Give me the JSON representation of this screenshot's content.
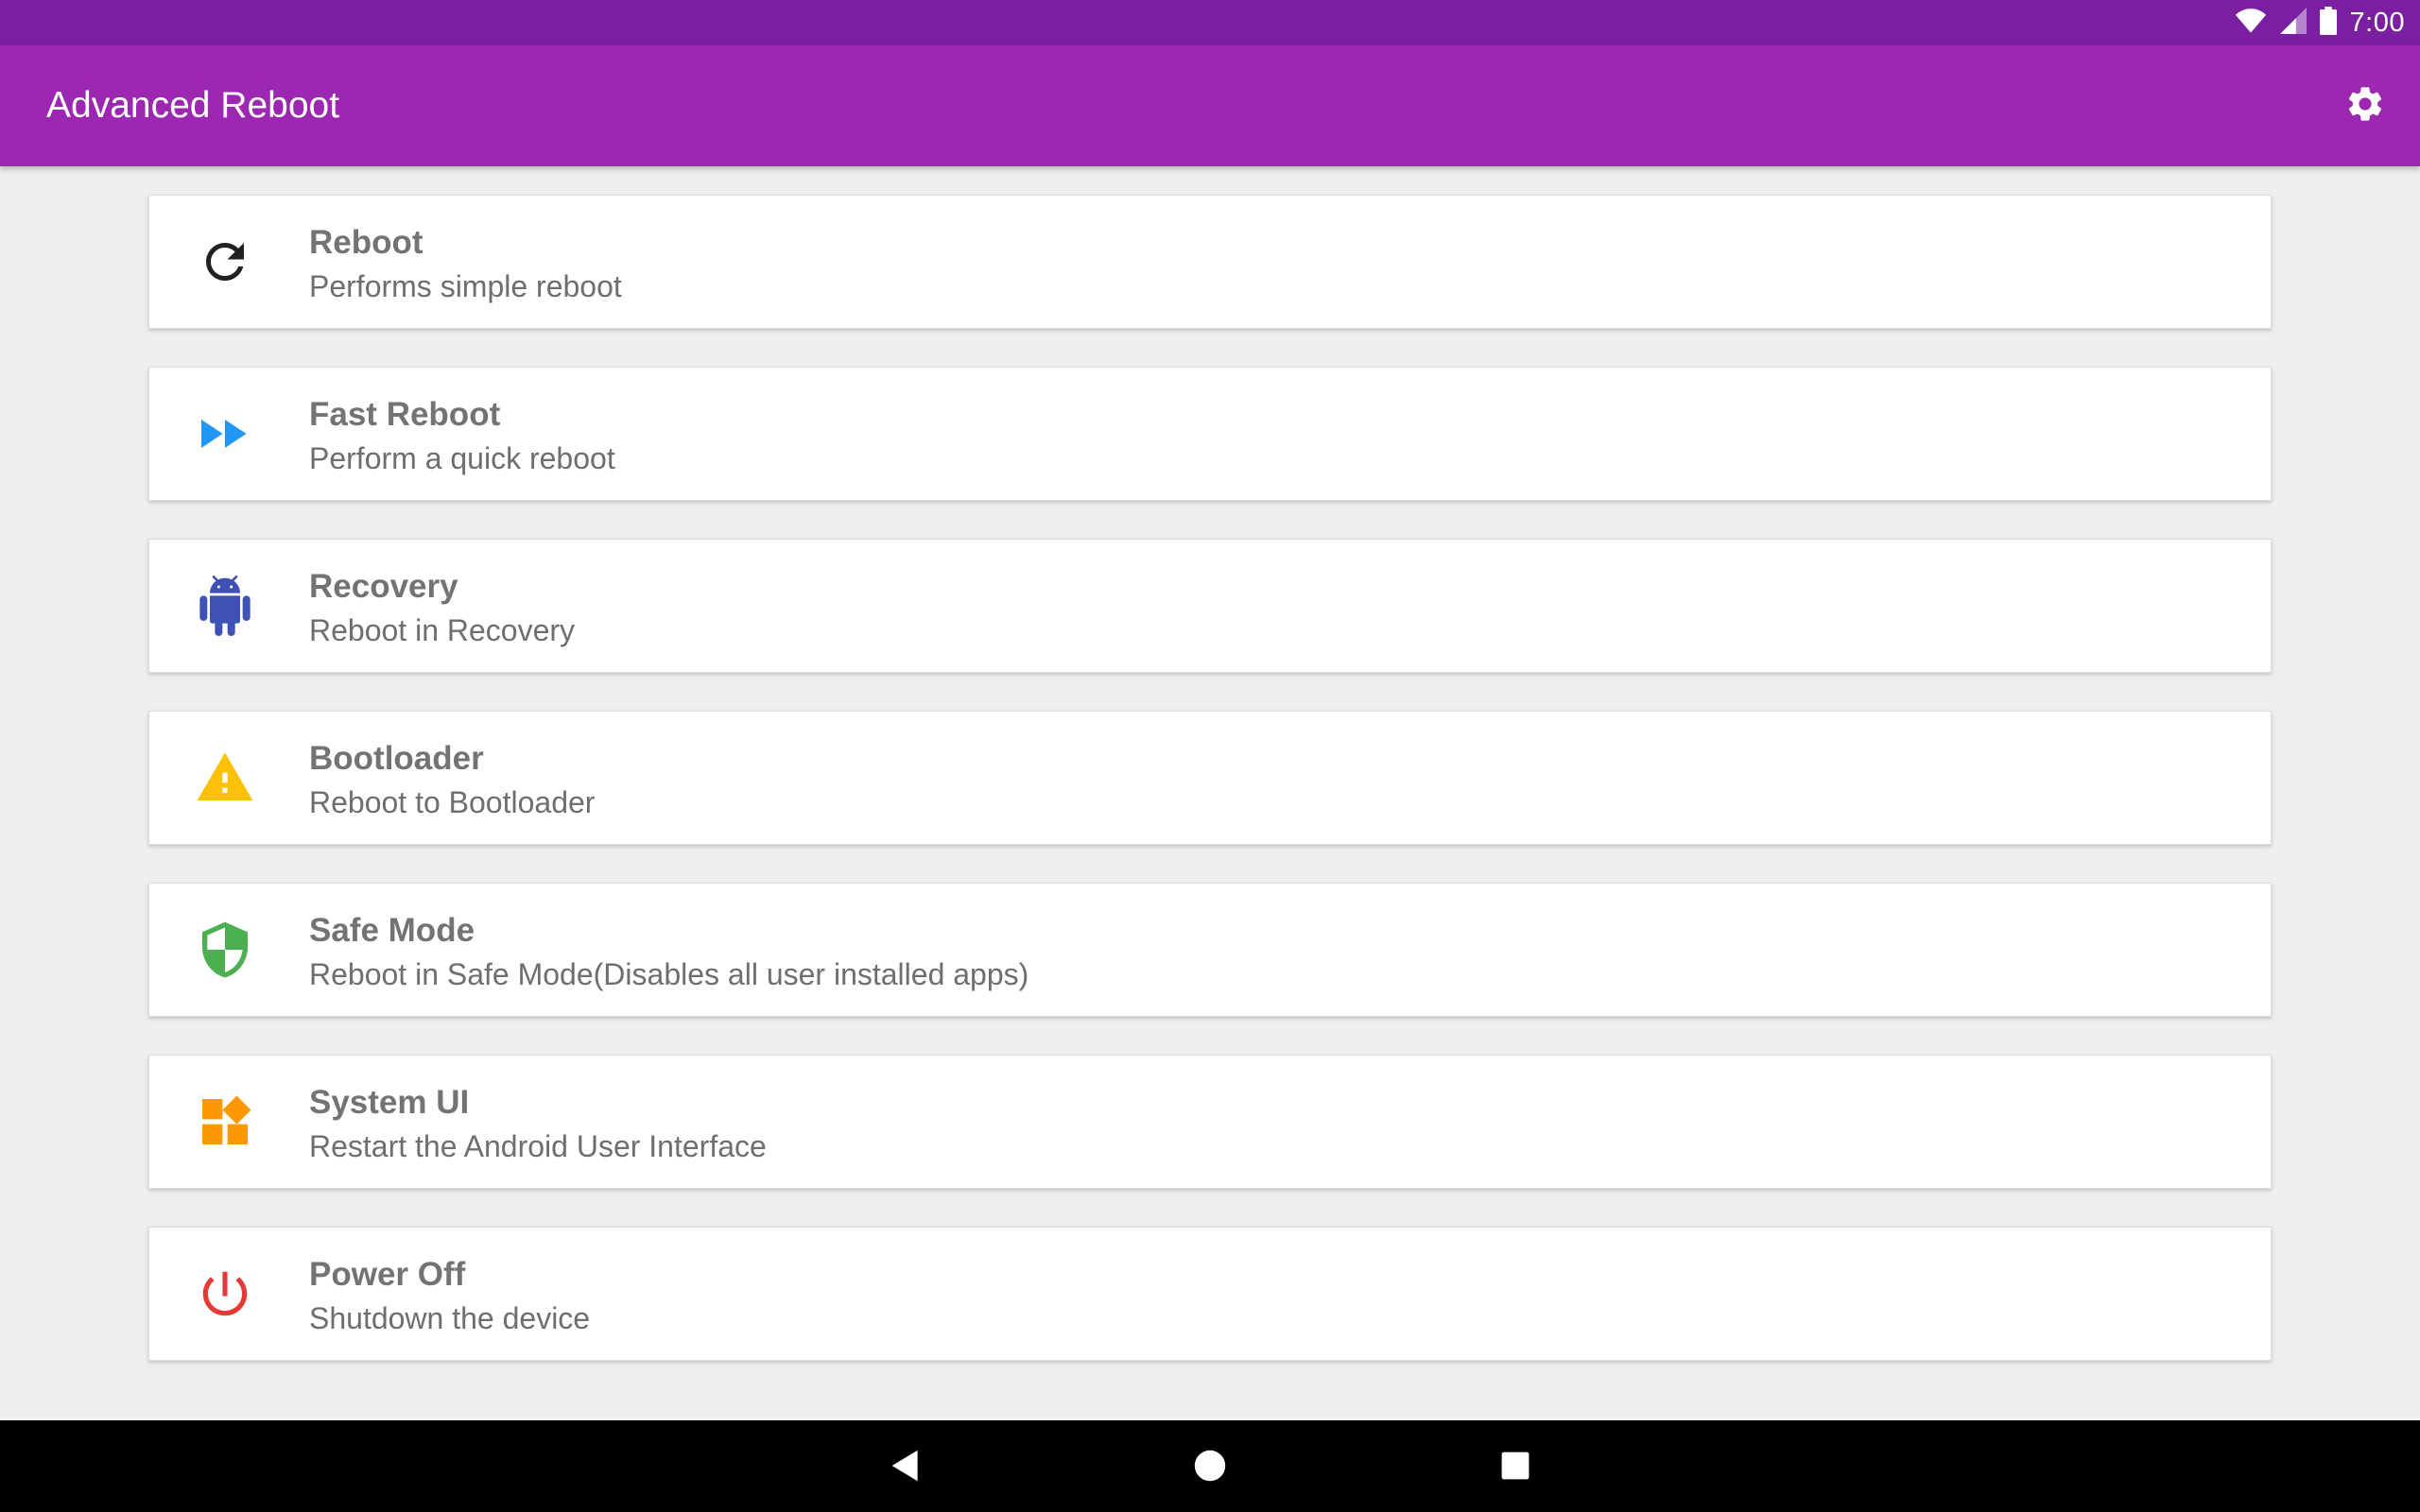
{
  "status_bar": {
    "time": "7:00",
    "icons": [
      "wifi-icon",
      "cell-signal-icon",
      "battery-icon"
    ]
  },
  "app_bar": {
    "title": "Advanced Reboot",
    "settings_icon": "gear-icon"
  },
  "options": [
    {
      "title": "Reboot",
      "subtitle": "Performs simple reboot",
      "icon": "refresh-icon",
      "icon_color": "#212121"
    },
    {
      "title": "Fast Reboot",
      "subtitle": "Perform a quick reboot",
      "icon": "fast-forward-icon",
      "icon_color": "#2196f3"
    },
    {
      "title": "Recovery",
      "subtitle": "Reboot in Recovery",
      "icon": "android-icon",
      "icon_color": "#3f51b5"
    },
    {
      "title": "Bootloader",
      "subtitle": "Reboot to Bootloader",
      "icon": "warning-icon",
      "icon_color": "#ffc107"
    },
    {
      "title": "Safe Mode",
      "subtitle": "Reboot in Safe Mode(Disables all user installed apps)",
      "icon": "shield-icon",
      "icon_color": "#4caf50"
    },
    {
      "title": "System UI",
      "subtitle": "Restart the Android User Interface",
      "icon": "widgets-icon",
      "icon_color": "#ff9800"
    },
    {
      "title": "Power Off",
      "subtitle": "Shutdown the device",
      "icon": "power-icon",
      "icon_color": "#e53935"
    }
  ],
  "nav_bar": {
    "buttons": [
      "back-icon",
      "home-icon",
      "recents-icon"
    ]
  },
  "colors": {
    "status_bar": "#7b1fa2",
    "app_bar": "#9c27b0",
    "background": "#efeef1"
  }
}
